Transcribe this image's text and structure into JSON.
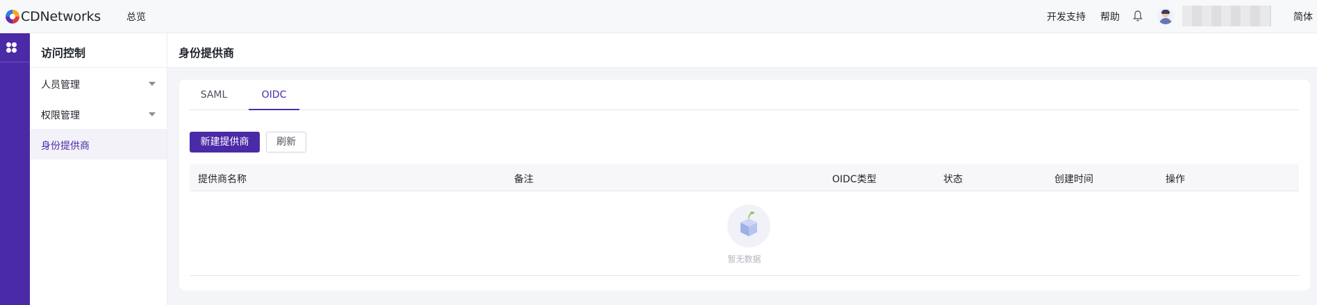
{
  "topbar": {
    "brand": "CDNetworks",
    "nav_overview": "总览",
    "dev_support": "开发支持",
    "help": "帮助",
    "language": "简体"
  },
  "sidebar": {
    "title": "访问控制",
    "items": [
      {
        "label": "人员管理",
        "expandable": true
      },
      {
        "label": "权限管理",
        "expandable": true
      },
      {
        "label": "身份提供商",
        "active": true
      }
    ]
  },
  "page": {
    "title": "身份提供商",
    "tabs": [
      {
        "label": "SAML"
      },
      {
        "label": "OIDC",
        "active": true
      }
    ],
    "buttons": {
      "create": "新建提供商",
      "refresh": "刷新"
    },
    "table": {
      "columns": [
        "提供商名称",
        "备注",
        "OIDC类型",
        "状态",
        "创建时间",
        "操作"
      ],
      "rows": [],
      "empty_text": "暂无数据"
    }
  },
  "colors": {
    "brand_purple": "#4b2aa7",
    "background": "#f4f5f9"
  }
}
